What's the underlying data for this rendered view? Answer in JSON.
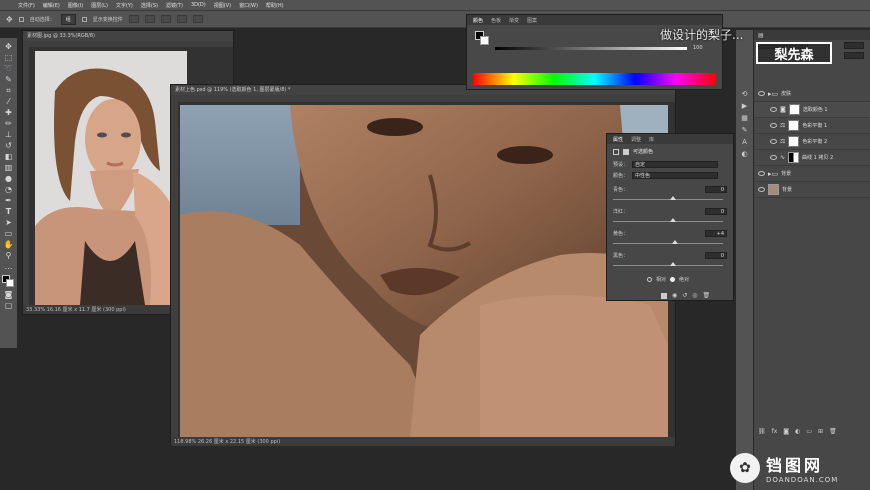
{
  "menu": [
    "文件(F)",
    "编辑(E)",
    "图像(I)",
    "图层(L)",
    "文字(Y)",
    "选择(S)",
    "滤镜(T)",
    "3D(D)",
    "视图(V)",
    "窗口(W)",
    "帮助(H)"
  ],
  "options": {
    "auto_select": "自动选择：",
    "group": "组",
    "show_transform": "显示变换控件"
  },
  "doc1": {
    "tab": "素材图.jpg @ 33.3%(RGB/8)",
    "status": "33.33%  16.16 厘米 x 11.7 厘米 (300 ppi)"
  },
  "doc2": {
    "tab": "素材上色.psd @ 119% (选取颜色 1, 图层蒙版/8) *",
    "status": "118.98%  26.26 厘米 x 22.15 厘米 (300 ppi)"
  },
  "color_panel": {
    "tabs": [
      "颜色",
      "色板",
      "渐变",
      "图案"
    ],
    "value": "100"
  },
  "properties": {
    "tabs": [
      "属性",
      "调整",
      "库"
    ],
    "title": "可选颜色",
    "preset_label": "预设：",
    "preset_value": "自定",
    "color_label": "颜色：",
    "color_value": "中性色",
    "sliders": [
      {
        "label": "青色：",
        "value": "0",
        "pos": 0.52
      },
      {
        "label": "洋红：",
        "value": "0",
        "pos": 0.52
      },
      {
        "label": "黄色：",
        "value": "+4",
        "pos": 0.54
      },
      {
        "label": "黑色：",
        "value": "0",
        "pos": 0.52
      }
    ],
    "method_relative": "相对",
    "method_absolute": "绝对"
  },
  "layers": [
    {
      "name": "皮肤",
      "type": "folder",
      "selected": false
    },
    {
      "name": "选取颜色 1",
      "type": "adj",
      "selected": true
    },
    {
      "name": "色彩平衡 1",
      "type": "adj",
      "selected": false
    },
    {
      "name": "色彩平衡 2",
      "type": "adj",
      "selected": false
    },
    {
      "name": "曲线 1 拷贝 2",
      "type": "curve",
      "selected": false
    },
    {
      "name": "背景",
      "type": "folder",
      "selected": false
    },
    {
      "name": "背景",
      "type": "image",
      "selected": false
    }
  ],
  "overlay": {
    "caption": "做设计的梨子...",
    "logo": "梨先森"
  },
  "watermark": {
    "name": "铛图网",
    "url": "DOANDOAN.COM"
  }
}
